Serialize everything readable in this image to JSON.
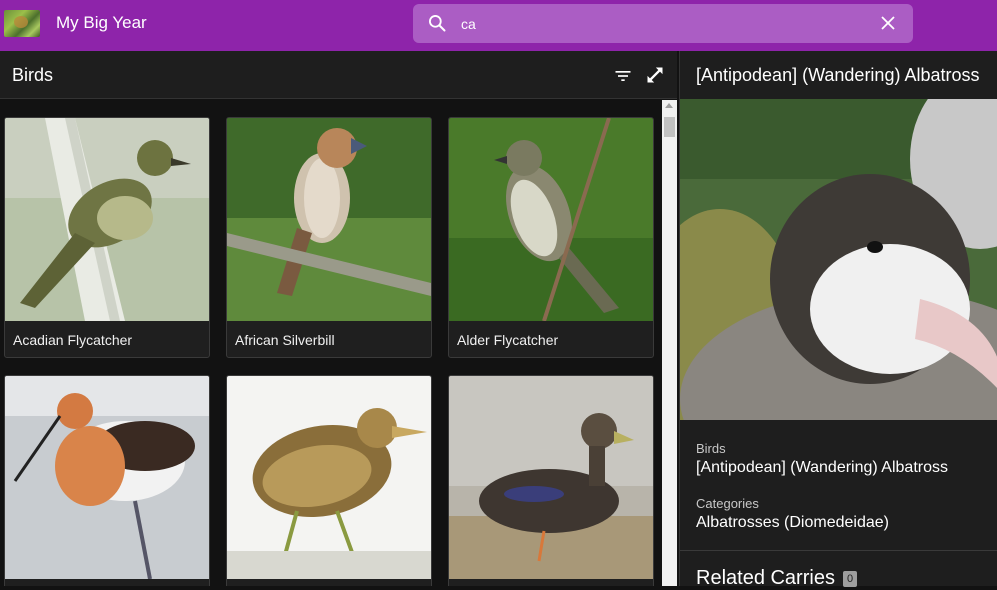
{
  "app": {
    "title": "My Big Year"
  },
  "search": {
    "value": "ca"
  },
  "list": {
    "title": "Birds",
    "items": [
      {
        "label": "Acadian Flycatcher"
      },
      {
        "label": "African Silverbill"
      },
      {
        "label": "Alder Flycatcher"
      },
      {
        "label": ""
      },
      {
        "label": ""
      },
      {
        "label": ""
      }
    ]
  },
  "detail": {
    "title": "[Antipodean] (Wandering) Albatross",
    "fields": [
      {
        "label": "Birds",
        "value": "[Antipodean] (Wandering) Albatross"
      },
      {
        "label": "Categories",
        "value": "Albatrosses (Diomedeidae)"
      }
    ],
    "related": {
      "label": "Related Carries",
      "count": "0"
    }
  },
  "colors": {
    "topbar": "#8e24aa",
    "search_bg": "#ab5dc4",
    "pane_bg": "#1e1e1e",
    "badge": "#9e9e9e"
  },
  "icons": [
    "search-icon",
    "close-icon",
    "filter-icon",
    "expand-icon"
  ]
}
